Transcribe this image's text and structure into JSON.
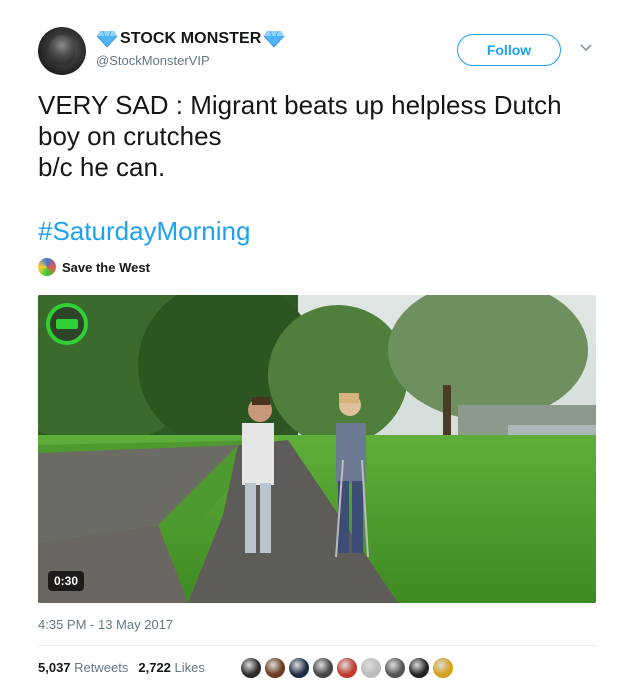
{
  "header": {
    "display_name": "STOCK MONSTER",
    "username": "@StockMonsterVIP",
    "follow_label": "Follow",
    "badge_icon": "diamond-icon",
    "accent_color": "#1da1f2"
  },
  "tweet": {
    "text": "VERY SAD : Migrant beats up helpless Dutch boy on crutches\n b/c he can.",
    "hashtag": "#SaturdayMorning"
  },
  "attribution": {
    "name": "Save the West"
  },
  "media": {
    "duration": "0:30",
    "type": "video"
  },
  "footer": {
    "timestamp": "4:35 PM - 13 May 2017",
    "retweets_count": "5,037",
    "retweets_label": "Retweets",
    "likes_count": "2,722",
    "likes_label": "Likes",
    "liker_avatars": [
      "#2b2b2b",
      "#6b3a1e",
      "#1c2c44",
      "#444444",
      "#c0392b",
      "#bbbbbb",
      "#555555",
      "#222222",
      "#d4a017"
    ]
  }
}
